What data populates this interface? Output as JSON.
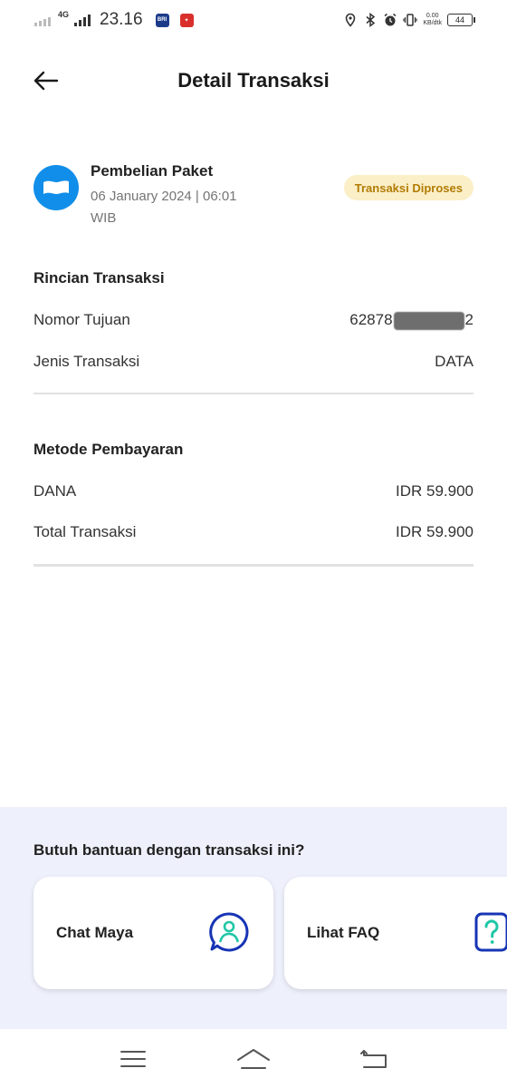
{
  "status_bar": {
    "network": "4G",
    "time": "23.16",
    "speed_value": "0.00",
    "speed_unit": "KB/dtk",
    "battery": "44"
  },
  "header": {
    "title": "Detail Transaksi"
  },
  "transaction": {
    "name": "Pembelian Paket",
    "datetime": "06 January 2024 | 06:01 WIB",
    "status": "Transaksi Diproses",
    "logo_color": "#118ee9",
    "status_bg": "#fbefc7",
    "status_color": "#b27c06"
  },
  "details": {
    "title": "Rincian Transaksi",
    "rows": [
      {
        "label": "Nomor Tujuan",
        "value_prefix": "62878",
        "value_suffix": "2"
      },
      {
        "label": "Jenis Transaksi",
        "value": "DATA"
      }
    ]
  },
  "payment": {
    "title": "Metode Pembayaran",
    "rows": [
      {
        "label": "DANA",
        "value": "IDR 59.900"
      },
      {
        "label": "Total Transaksi",
        "value": "IDR 59.900"
      }
    ]
  },
  "help": {
    "title": "Butuh bantuan dengan transaksi ini?",
    "cards": [
      {
        "label": "Chat Maya",
        "icon": "chat-support-icon"
      },
      {
        "label": "Lihat FAQ",
        "icon": "faq-question-icon"
      }
    ],
    "accent": "#1734b5",
    "icon_accent": "#1fc7a6"
  },
  "nav": {
    "icons": [
      "menu-icon",
      "home-icon",
      "back-nav-icon"
    ]
  }
}
